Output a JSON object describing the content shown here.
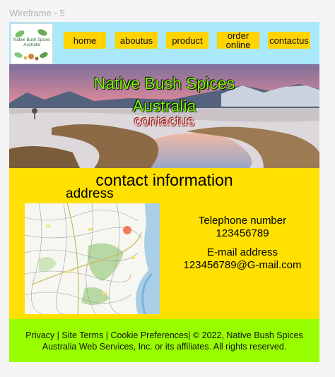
{
  "frame_label": "Wireframe - 5",
  "header": {
    "logo_text": "Native Bush Spices Australia",
    "nav": [
      "home",
      "aboutus",
      "product",
      "order online",
      "contactus"
    ]
  },
  "hero": {
    "title_line1": "Native Bush Spices",
    "title_line2": "Australia",
    "subtitle": "contactus"
  },
  "contact": {
    "heading": "contact information",
    "address_label": "address",
    "phone_label": "Telephone number",
    "phone_value": "123456789",
    "email_label": "E-mail address",
    "email_value": "123456789@G-mail.com"
  },
  "footer": {
    "links": [
      "Privacy",
      "Site Terms",
      "Cookie Preferences"
    ],
    "sep": "|",
    "copyright": "© 2022, Native Bush Spices Australia Web Services, Inc. or its affiliates. All rights reserved."
  },
  "colors": {
    "header_bg": "#a9e9fb",
    "nav_button": "#ffd400",
    "contact_bg": "#ffe000",
    "footer_bg": "#99ff00",
    "hero_title": "#7cfc00"
  }
}
